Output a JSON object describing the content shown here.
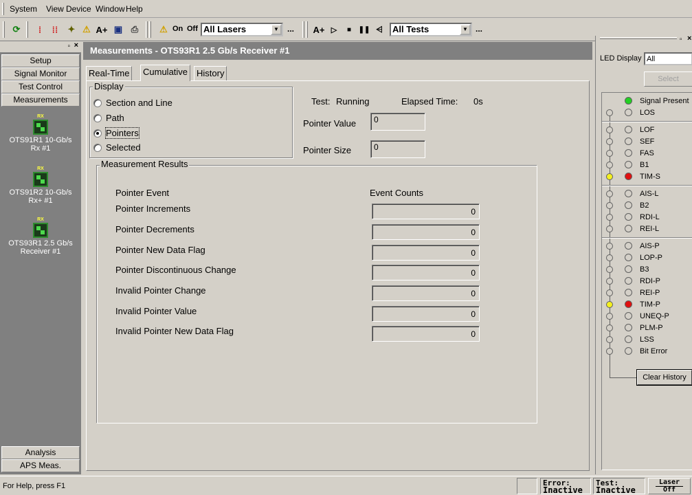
{
  "menubar": {
    "items": [
      {
        "label": "System"
      },
      {
        "label": "View"
      },
      {
        "label": "Device"
      },
      {
        "label": "Window"
      },
      {
        "label": "Help"
      }
    ]
  },
  "toolbar": {
    "on_label": "On",
    "off_label": "Off",
    "lasers_combo": "All Lasers",
    "tests_combo": "All Tests",
    "ellipsis": "...",
    "aplus": "A+"
  },
  "leftnav": {
    "top_buttons": [
      "Setup",
      "Signal Monitor",
      "Test Control",
      "Measurements"
    ],
    "devices": [
      {
        "badge": "RX",
        "name1": "OTS91R1 10-Gb/s",
        "name2": "Rx #1"
      },
      {
        "badge": "RX",
        "name1": "OTS91R2 10-Gb/s",
        "name2": "Rx+ #1"
      },
      {
        "badge": "RX",
        "name1": "OTS93R1 2.5 Gb/s",
        "name2": "Receiver #1"
      }
    ],
    "bottom_buttons": [
      "Analysis",
      "APS Meas."
    ]
  },
  "main": {
    "title": "Measurements - OTS93R1 2.5 Gb/s Receiver #1",
    "tabs": [
      "Real-Time",
      "Cumulative",
      "History"
    ],
    "active_tab": "Cumulative",
    "display": {
      "label": "Display",
      "options": [
        "Section and Line",
        "Path",
        "Pointers",
        "Selected"
      ],
      "selected": "Pointers"
    },
    "test_label": "Test:",
    "test_status": "Running",
    "elapsed_label": "Elapsed Time:",
    "elapsed_value": "0s",
    "pointer_value_label": "Pointer Value",
    "pointer_value": "0",
    "pointer_size_label": "Pointer Size",
    "pointer_size": "0",
    "results": {
      "label": "Measurement Results",
      "col_event": "Pointer Event",
      "col_counts": "Event Counts",
      "rows": [
        {
          "name": "Pointer Increments",
          "count": "0"
        },
        {
          "name": "Pointer Decrements",
          "count": "0"
        },
        {
          "name": "Pointer New Data Flag",
          "count": "0"
        },
        {
          "name": "Pointer Discontinuous Change",
          "count": "0"
        },
        {
          "name": "Invalid Pointer Change",
          "count": "0"
        },
        {
          "name": "Invalid Pointer Value",
          "count": "0"
        },
        {
          "name": "Invalid Pointer New Data Flag",
          "count": "0"
        }
      ]
    }
  },
  "rightpanel": {
    "led_display_label": "LED Display",
    "led_display_value": "All",
    "select_label": "Select",
    "clear_history": "Clear History",
    "leds": [
      {
        "name": "Signal Present",
        "history": null,
        "current": "green"
      },
      {
        "name": "LOS",
        "history": "off",
        "current": "off"
      },
      {
        "name": "LOF",
        "history": "off",
        "current": "off"
      },
      {
        "name": "SEF",
        "history": "off",
        "current": "off"
      },
      {
        "name": "FAS",
        "history": "off",
        "current": "off"
      },
      {
        "name": "B1",
        "history": "off",
        "current": "off"
      },
      {
        "name": "TIM-S",
        "history": "yellow",
        "current": "red"
      },
      {
        "name": "AIS-L",
        "history": "off",
        "current": "off"
      },
      {
        "name": "B2",
        "history": "off",
        "current": "off"
      },
      {
        "name": "RDI-L",
        "history": "off",
        "current": "off"
      },
      {
        "name": "REI-L",
        "history": "off",
        "current": "off"
      },
      {
        "name": "AIS-P",
        "history": "off",
        "current": "off"
      },
      {
        "name": "LOP-P",
        "history": "off",
        "current": "off"
      },
      {
        "name": "B3",
        "history": "off",
        "current": "off"
      },
      {
        "name": "RDI-P",
        "history": "off",
        "current": "off"
      },
      {
        "name": "REI-P",
        "history": "off",
        "current": "off"
      },
      {
        "name": "TIM-P",
        "history": "yellow",
        "current": "red"
      },
      {
        "name": "UNEQ-P",
        "history": "off",
        "current": "off"
      },
      {
        "name": "PLM-P",
        "history": "off",
        "current": "off"
      },
      {
        "name": "LSS",
        "history": "off",
        "current": "off"
      },
      {
        "name": "Bit Error",
        "history": "off",
        "current": "off"
      }
    ]
  },
  "colors": {
    "green": "#22d022",
    "red": "#e01010",
    "yellow": "#f4f020",
    "off": "#d4d0c8"
  },
  "statusbar": {
    "help": "For Help, press F1",
    "error_label": "Error:",
    "error_value": "Inactive",
    "test_label": "Test:",
    "test_value": "Inactive",
    "laser_label": "Laser",
    "laser_value": "Off"
  }
}
